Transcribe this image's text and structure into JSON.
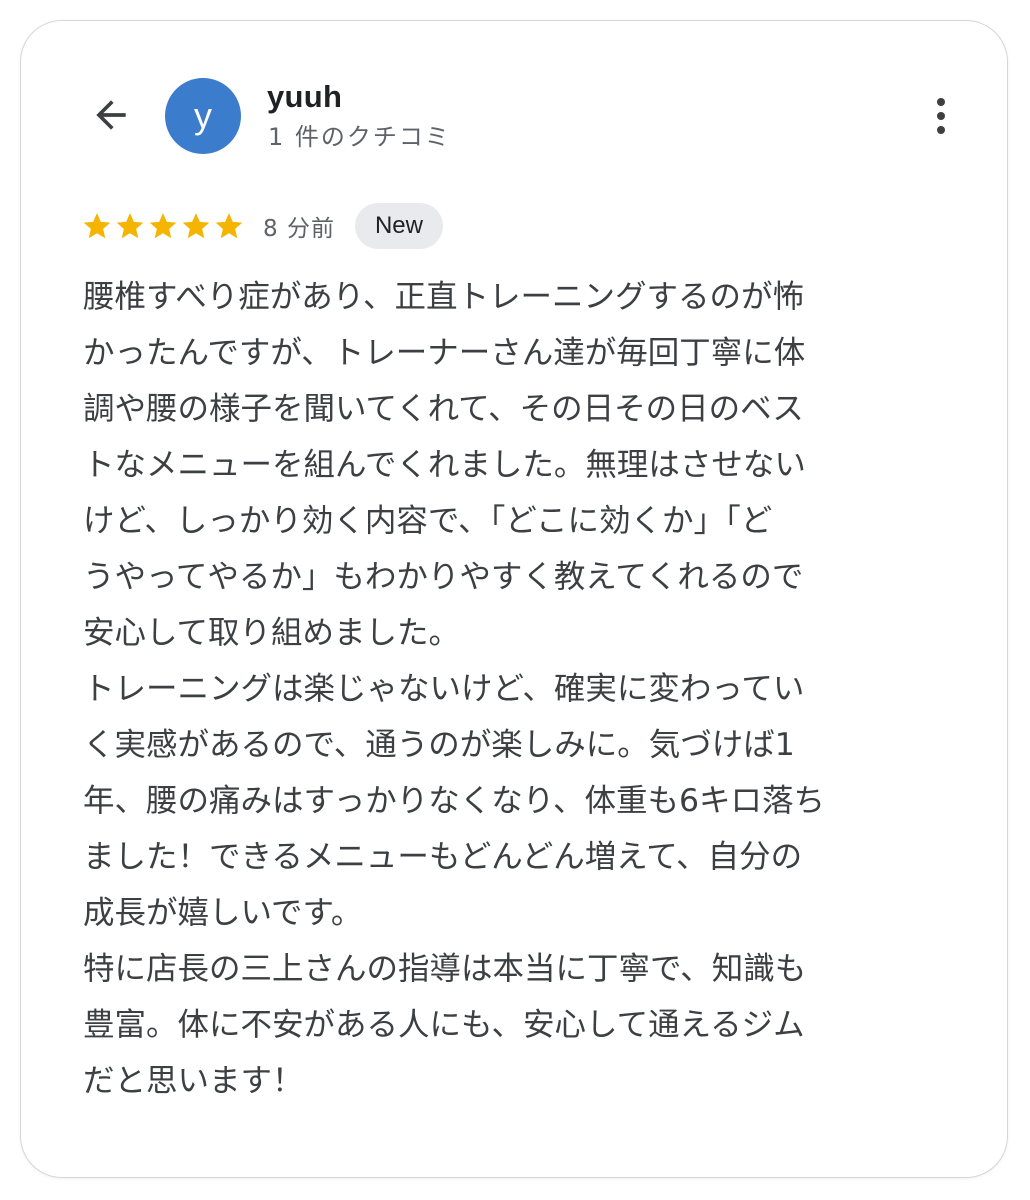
{
  "review": {
    "author_initial": "y",
    "author_name": "yuuh",
    "author_review_count": "1 件のクチコミ",
    "rating": 5,
    "rating_max": 5,
    "time_ago": "8 分前",
    "badge": "New",
    "text_lines": [
      "腰椎すべり症があり、正直トレーニングするのが怖",
      "かったんですが、トレーナーさん達が毎回丁寧に体",
      "調や腰の様子を聞いてくれて、その日その日のベス",
      "トなメニューを組んでくれました。無理はさせない",
      "けど、しっかり効く内容で、「どこに効くか」「ど",
      "うやってやるか」もわかりやすく教えてくれるので",
      "安心して取り組めました。",
      "トレーニングは楽じゃないけど、確実に変わってい",
      "く実感があるので、通うのが楽しみに。気づけば1",
      "年、腰の痛みはすっかりなくなり、体重も6キロ落ち",
      "ました！できるメニューもどんどん増えて、自分の",
      "成長が嬉しいです。",
      "特に店長の三上さんの指導は本当に丁寧で、知識も",
      "豊富。体に不安がある人にも、安心して通えるジム",
      "だと思います！"
    ]
  },
  "icons": {
    "back": "arrow-back-icon",
    "menu": "more-vert-icon",
    "star": "star-icon"
  },
  "colors": {
    "avatar_bg": "#3c7ccc",
    "star": "#f4b400",
    "badge_bg": "#e8eaed"
  }
}
